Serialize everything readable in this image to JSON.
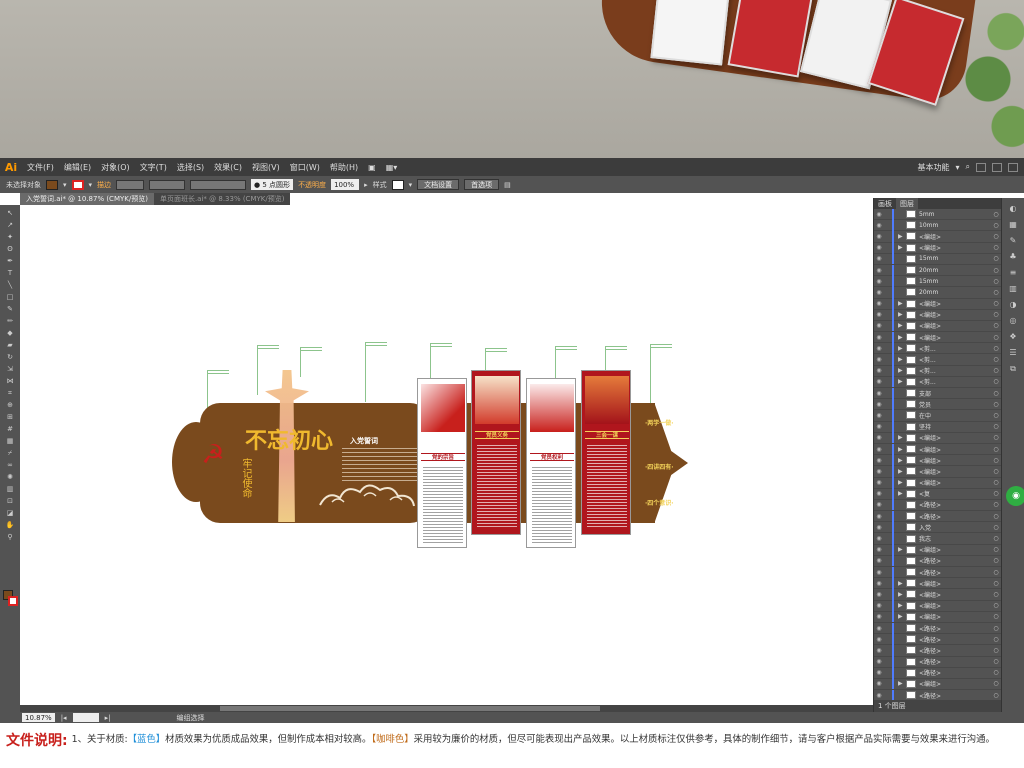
{
  "app": {
    "logo": "Ai",
    "menus": [
      "文件(F)",
      "编辑(E)",
      "对象(O)",
      "文字(T)",
      "选择(S)",
      "效果(C)",
      "视图(V)",
      "窗口(W)",
      "帮助(H)"
    ],
    "workspace": "基本功能"
  },
  "control_bar": {
    "selection_status": "未选择对象",
    "stroke_label": "描边",
    "point_value": "5 点圆形",
    "opacity_label": "不透明度",
    "opacity_value": "100%",
    "style_label": "样式",
    "doc_setup": "文档设置",
    "preferences": "首选项"
  },
  "tabs": [
    {
      "label": "入党誓词.ai* @ 10.87% (CMYK/预览)"
    },
    {
      "label": "单页面班长.ai* @ 8.33% (CMYK/预览)"
    }
  ],
  "status_bar": {
    "zoom": "10.87%",
    "tool_status": "编组选择"
  },
  "layers_panel": {
    "tab_layers": "图层",
    "tab_other": "画板",
    "footer": "1 个图层",
    "rows": [
      {
        "name": "5mm",
        "tri": ""
      },
      {
        "name": "10mm",
        "tri": ""
      },
      {
        "name": "<编组>",
        "tri": "▶"
      },
      {
        "name": "<编组>",
        "tri": "▶"
      },
      {
        "name": "15mm",
        "tri": ""
      },
      {
        "name": "20mm",
        "tri": ""
      },
      {
        "name": "15mm",
        "tri": ""
      },
      {
        "name": "20mm",
        "tri": ""
      },
      {
        "name": "<编组>",
        "tri": "▶"
      },
      {
        "name": "<编组>",
        "tri": "▶"
      },
      {
        "name": "<编组>",
        "tri": "▶"
      },
      {
        "name": "<编组>",
        "tri": "▶"
      },
      {
        "name": "<剪...",
        "tri": "▶"
      },
      {
        "name": "<剪...",
        "tri": "▶"
      },
      {
        "name": "<剪...",
        "tri": "▶"
      },
      {
        "name": "<剪...",
        "tri": "▶"
      },
      {
        "name": "支部",
        "tri": ""
      },
      {
        "name": "党员",
        "tri": ""
      },
      {
        "name": "在中",
        "tri": ""
      },
      {
        "name": "坚持",
        "tri": ""
      },
      {
        "name": "<编组>",
        "tri": "▶"
      },
      {
        "name": "<编组>",
        "tri": "▶"
      },
      {
        "name": "<编组>",
        "tri": "▶"
      },
      {
        "name": "<编组>",
        "tri": "▶"
      },
      {
        "name": "<编组>",
        "tri": "▶"
      },
      {
        "name": "<复",
        "tri": "▶"
      },
      {
        "name": "<路径>",
        "tri": ""
      },
      {
        "name": "<路径>",
        "tri": ""
      },
      {
        "name": "入党",
        "tri": ""
      },
      {
        "name": "我志",
        "tri": ""
      },
      {
        "name": "<编组>",
        "tri": "▶"
      },
      {
        "name": "<路径>",
        "tri": ""
      },
      {
        "name": "<路径>",
        "tri": ""
      },
      {
        "name": "<编组>",
        "tri": "▶"
      },
      {
        "name": "<编组>",
        "tri": "▶"
      },
      {
        "name": "<编组>",
        "tri": "▶"
      },
      {
        "name": "<编组>",
        "tri": "▶"
      },
      {
        "name": "<路径>",
        "tri": ""
      },
      {
        "name": "<路径>",
        "tri": ""
      },
      {
        "name": "<路径>",
        "tri": ""
      },
      {
        "name": "<路径>",
        "tri": ""
      },
      {
        "name": "<路径>",
        "tri": ""
      },
      {
        "name": "<编组>",
        "tri": "▶"
      },
      {
        "name": "<路径>",
        "tri": ""
      },
      {
        "name": "<路径>",
        "tri": ""
      }
    ]
  },
  "artwork": {
    "calligraphy": "不忘初心",
    "calligraphy_sub": "牢记使命",
    "emblem": "☭",
    "oath_title": "入党誓词",
    "cards": [
      {
        "style": "white",
        "title": "党的宗旨"
      },
      {
        "style": "red",
        "title": "党员义务"
      },
      {
        "style": "white",
        "title": "党员权利"
      },
      {
        "style": "red",
        "title": "三会一课"
      }
    ],
    "side_labels": [
      "·两学一做·",
      "·四讲四有·",
      "·四个意识·"
    ]
  },
  "footer": {
    "title": "文件说明:",
    "prefix": "1、关于材质:",
    "blue_tag": "【蓝色】",
    "mid1": "材质效果为优质成品效果，但制作成本相对较高。",
    "brown_tag": "【咖啡色】",
    "mid2": "采用较为廉价的材质，但尽可能表现出产品效果。以上材质标注仅供参考，具体的制作细节，请与客户根据产品实际需要与效果来进行沟通。"
  },
  "colors": {
    "brown": "#7a4a1d",
    "party_red": "#b0161d",
    "gold": "#f0b92e",
    "ui_dark": "#535353",
    "footer_red": "#c8201c"
  }
}
